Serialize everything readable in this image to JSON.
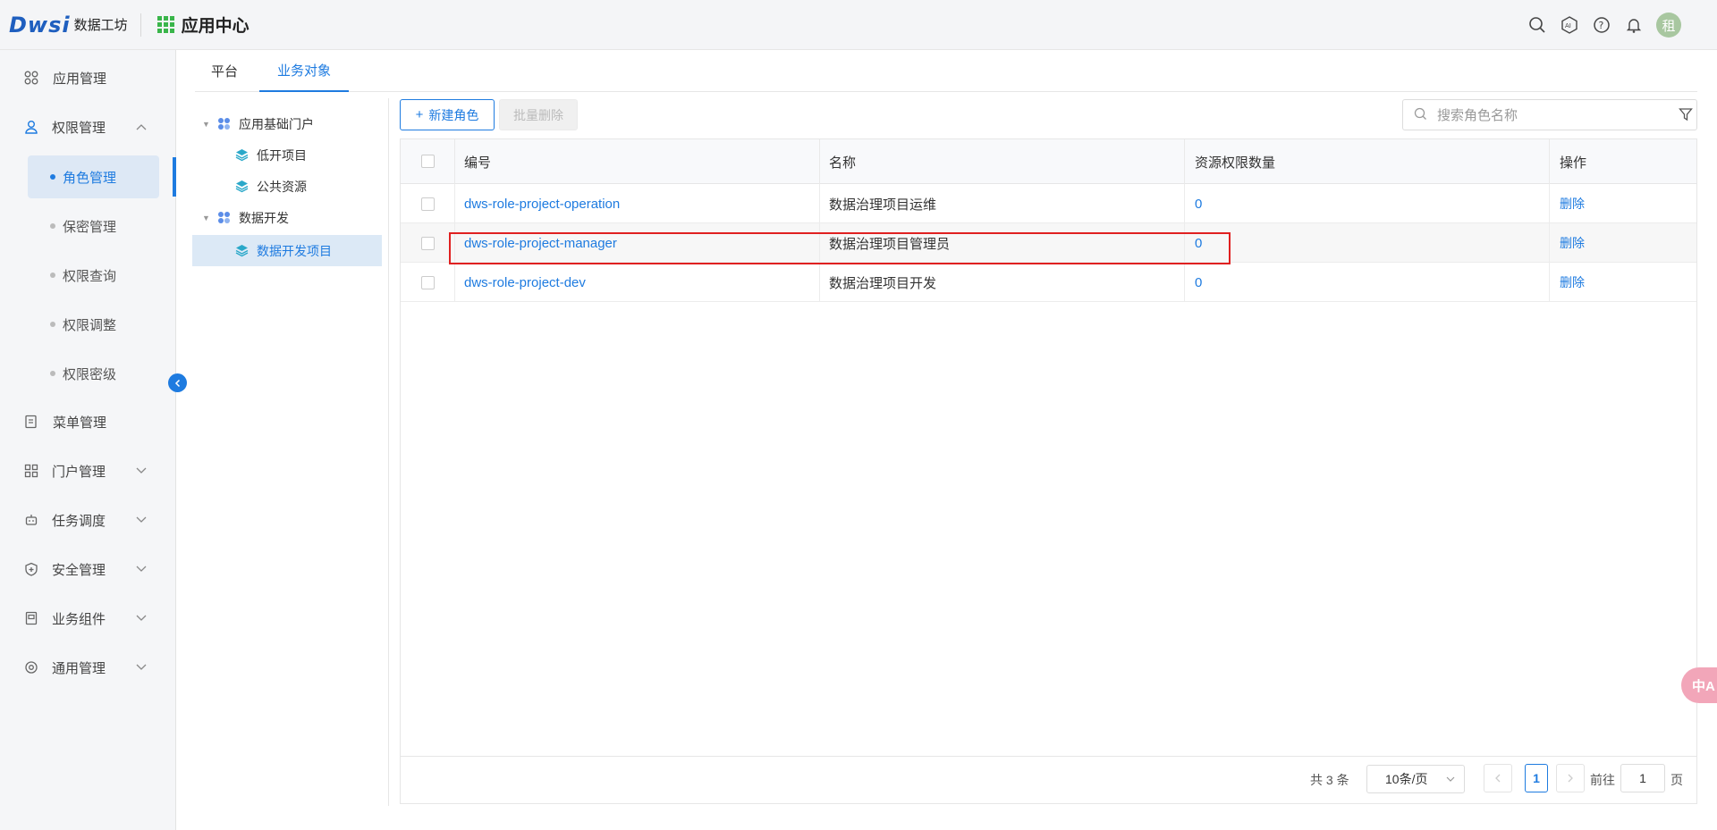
{
  "header": {
    "logo_text": "Dwsi",
    "logo_subtitle": "数据工坊",
    "app_title": "应用中心",
    "avatar_text": "租"
  },
  "sidebar": {
    "items": [
      {
        "label": "应用管理",
        "icon": "apps-icon"
      },
      {
        "label": "权限管理",
        "icon": "user-icon"
      },
      {
        "label": "菜单管理",
        "icon": "doc-icon"
      },
      {
        "label": "门户管理",
        "icon": "apps-icon"
      },
      {
        "label": "任务调度",
        "icon": "robot-icon"
      },
      {
        "label": "安全管理",
        "icon": "shield-icon"
      },
      {
        "label": "业务组件",
        "icon": "component-icon"
      },
      {
        "label": "通用管理",
        "icon": "gear-icon"
      }
    ],
    "sub_items": [
      "角色管理",
      "保密管理",
      "权限查询",
      "权限调整",
      "权限密级"
    ]
  },
  "tabs": [
    "平台",
    "业务对象"
  ],
  "tree": {
    "nodes": [
      "应用基础门户",
      "低开项目",
      "公共资源",
      "数据开发",
      "数据开发项目"
    ]
  },
  "toolbar": {
    "new_label": "新建角色",
    "delete_label": "批量删除",
    "search_placeholder": "搜索角色名称"
  },
  "table": {
    "columns": [
      "编号",
      "名称",
      "资源权限数量",
      "操作"
    ],
    "rows": [
      {
        "code": "dws-role-project-operation",
        "name": "数据治理项目运维",
        "count": "0",
        "action": "删除"
      },
      {
        "code": "dws-role-project-manager",
        "name": "数据治理项目管理员",
        "count": "0",
        "action": "删除"
      },
      {
        "code": "dws-role-project-dev",
        "name": "数据治理项目开发",
        "count": "0",
        "action": "删除"
      }
    ]
  },
  "pagination": {
    "total": "共 3 条",
    "page_size": "10条/页",
    "current": "1",
    "goto_label": "前往",
    "goto_value": "1",
    "page_suffix": "页"
  },
  "float_button": "中A",
  "colors": {
    "accent": "#1e7be0",
    "highlight_border": "#e02020"
  }
}
